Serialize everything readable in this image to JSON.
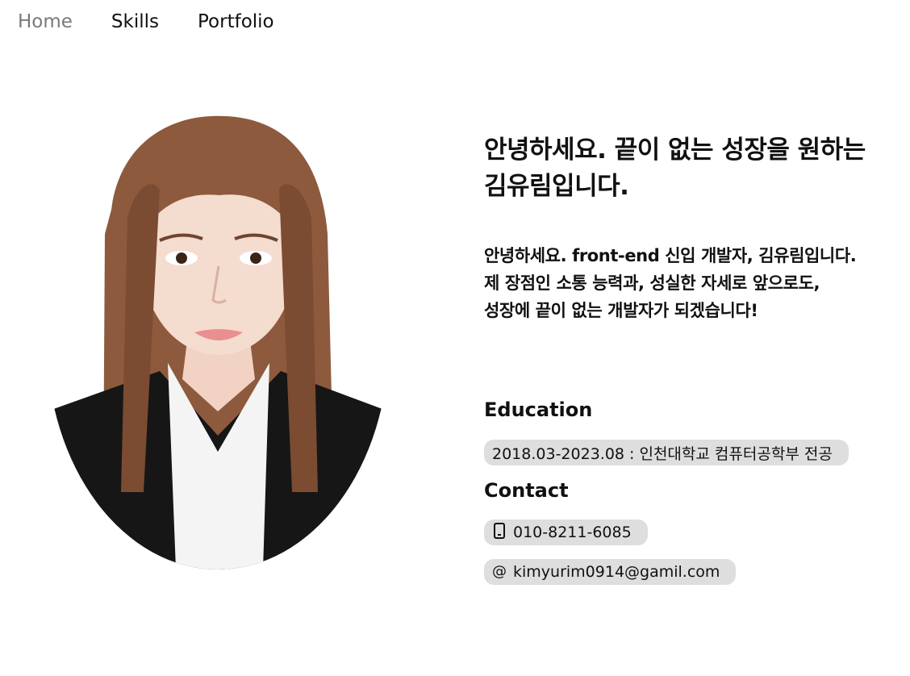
{
  "nav": {
    "home": "Home",
    "skills": "Skills",
    "portfolio": "Portfolio"
  },
  "hero": {
    "headline_line1": "안녕하세요. 끝이 없는 성장을 원하는",
    "headline_line2": "김유림입니다.",
    "intro_line1": "안녕하세요. front-end 신입 개발자, 김유림입니다.",
    "intro_line2": "제 장점인 소통 능력과, 성실한 자세로 앞으로도,",
    "intro_line3": "성장에 끝이 없는 개발자가 되겠습니다!"
  },
  "education": {
    "title": "Education",
    "item": "2018.03-2023.08 : 인천대학교 컴퓨터공학부 전공"
  },
  "contact": {
    "title": "Contact",
    "phone": "010-8211-6085",
    "email": "kimyurim0914@gamil.com"
  },
  "icons": {
    "phone": "mobile-phone-icon",
    "email": "at-sign-icon"
  },
  "colors": {
    "nav_active": "#7a7a7a",
    "pill_background": "#dedede",
    "text": "#111111"
  }
}
